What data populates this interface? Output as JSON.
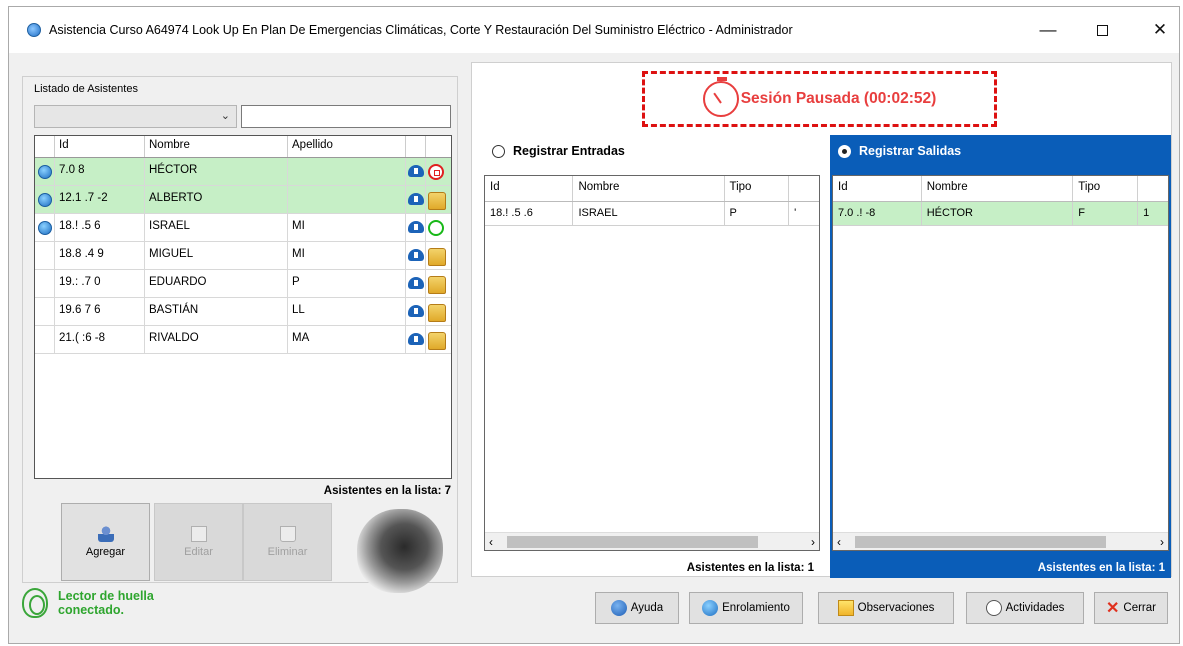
{
  "window": {
    "title": "Asistencia Curso A64974 Look Up En Plan De Emergencias Climáticas, Corte Y Restauración Del Suministro Eléctrico - Administrador",
    "minimize": "—",
    "close": "✕"
  },
  "left": {
    "group_label": "Listado de Asistentes",
    "combo_value": "",
    "search_value": "",
    "columns": [
      "Id",
      "Nombre",
      "Apellido"
    ],
    "rows": [
      {
        "id": "7.0      8",
        "nombre": "HÉCTOR",
        "apellido": "",
        "marked": true,
        "selected": true,
        "status": "red"
      },
      {
        "id": "12.1  .7  -2",
        "nombre": "ALBERTO",
        "apellido": "",
        "marked": true,
        "selected": true,
        "status": "person"
      },
      {
        "id": "18.!  .5  6",
        "nombre": "ISRAEL",
        "apellido": "MI",
        "marked": true,
        "selected": false,
        "status": "green"
      },
      {
        "id": "18.8  .4  9",
        "nombre": "MIGUEL",
        "apellido": "MI",
        "marked": false,
        "selected": false,
        "status": "person"
      },
      {
        "id": "19.:  .7  0",
        "nombre": "EDUARDO",
        "apellido": "P",
        "marked": false,
        "selected": false,
        "status": "person"
      },
      {
        "id": "19.6  7  6",
        "nombre": "BASTIÁN",
        "apellido": "LL",
        "marked": false,
        "selected": false,
        "status": "person"
      },
      {
        "id": "21.(  :6  -8",
        "nombre": "RIVALDO",
        "apellido": "MA",
        "marked": false,
        "selected": false,
        "status": "person"
      }
    ],
    "count_label": "Asistentes en la lista: 7",
    "buttons": {
      "add": "Agregar",
      "edit": "Editar",
      "delete": "Eliminar"
    }
  },
  "status": {
    "reader_text": "Lector de huella conectado."
  },
  "session": {
    "text": "Sesión Pausada (00:02:52)"
  },
  "entradas": {
    "label": "Registrar Entradas",
    "columns": [
      "Id",
      "Nombre",
      "Tipo"
    ],
    "rows": [
      {
        "id": "18.!  .5  .6",
        "nombre": "ISRAEL",
        "tipo": "P",
        "extra": "'"
      }
    ],
    "count_label": "Asistentes en la lista: 1"
  },
  "salidas": {
    "label": "Registrar Salidas",
    "columns": [
      "Id",
      "Nombre",
      "Tipo"
    ],
    "rows": [
      {
        "id": "7.0  .!  -8",
        "nombre": "HÉCTOR",
        "tipo": "F",
        "extra": "1"
      }
    ],
    "count_label": "Asistentes en la lista: 1"
  },
  "footer_buttons": {
    "ayuda": "Ayuda",
    "enrolamiento": "Enrolamiento",
    "observaciones": "Observaciones",
    "actividades": "Actividades",
    "cerrar": "Cerrar"
  },
  "colors": {
    "accent": "#0a5db8",
    "selected_row": "#c6efc6",
    "session_red": "#e83e3e",
    "status_green": "#2ea52e"
  }
}
